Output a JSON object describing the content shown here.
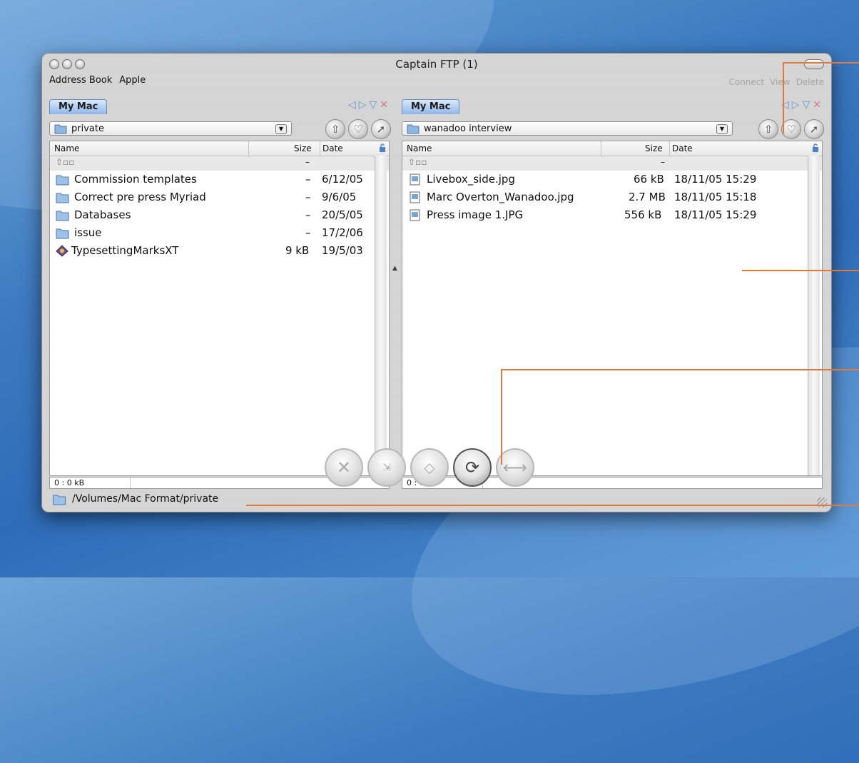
{
  "window": {
    "title": "Captain FTP (1)"
  },
  "toolbar": {
    "left_items": [
      "Address Book",
      "Apple"
    ],
    "right_items": [
      "Connect",
      "View",
      "Delete"
    ]
  },
  "left_pane": {
    "tab": "My Mac",
    "path": "private",
    "columns": {
      "name": "Name",
      "size": "Size",
      "date": "Date"
    },
    "parent_size": "–",
    "rows": [
      {
        "name": "Commission templates",
        "size": "–",
        "date": "6/12/05",
        "icon": "folder-icon"
      },
      {
        "name": "Correct pre press Myriad",
        "size": "–",
        "date": "9/6/05",
        "icon": "folder-icon"
      },
      {
        "name": "Databases",
        "size": "–",
        "date": "20/5/05",
        "icon": "folder-icon"
      },
      {
        "name": "issue",
        "size": "–",
        "date": "17/2/06",
        "icon": "folder-icon"
      },
      {
        "name": "TypesettingMarksXT",
        "size": "9 kB",
        "date": "19/5/03",
        "icon": "plugin-icon"
      }
    ],
    "status": "0 : 0 kB"
  },
  "right_pane": {
    "tab": "My Mac",
    "path": "wanadoo interview",
    "columns": {
      "name": "Name",
      "size": "Size",
      "date": "Date"
    },
    "parent_size": "–",
    "rows": [
      {
        "name": "Livebox_side.jpg",
        "size": "66 kB",
        "date": "18/11/05 15:29",
        "icon": "image-file-icon"
      },
      {
        "name": "Marc Overton_Wanadoo.jpg",
        "size": "2.7 MB",
        "date": "18/11/05 15:18",
        "icon": "image-file-icon"
      },
      {
        "name": "Press image 1.JPG",
        "size": "556 kB",
        "date": "18/11/05 15:29",
        "icon": "image-file-icon"
      }
    ],
    "status": "0 : 0 kB"
  },
  "transfer_buttons": [
    "stop-icon",
    "transfer-direction-icon",
    "sync-direction-icon",
    "refresh-icon",
    "disconnect-icon"
  ],
  "bottom_path": "/Volumes/Mac Format/private",
  "colors": {
    "accent_callout": "#e2783c",
    "tab_blue": "#8fb6e8"
  }
}
